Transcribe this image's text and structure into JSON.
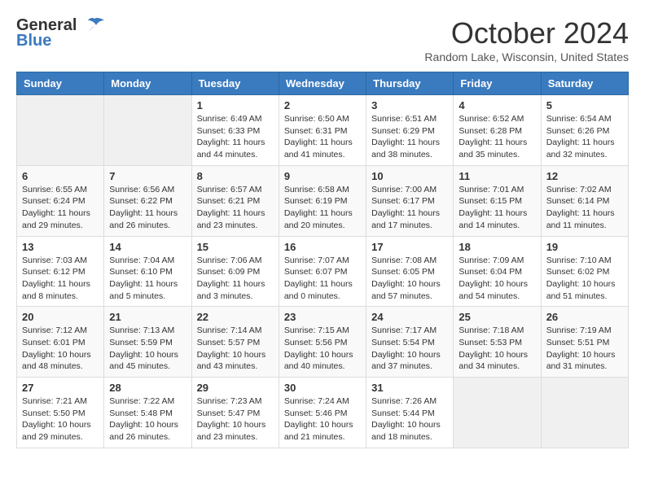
{
  "header": {
    "logo_line1": "General",
    "logo_line2": "Blue",
    "month_title": "October 2024",
    "location": "Random Lake, Wisconsin, United States"
  },
  "days_of_week": [
    "Sunday",
    "Monday",
    "Tuesday",
    "Wednesday",
    "Thursday",
    "Friday",
    "Saturday"
  ],
  "weeks": [
    [
      {
        "day": "",
        "sunrise": "",
        "sunset": "",
        "daylight": ""
      },
      {
        "day": "",
        "sunrise": "",
        "sunset": "",
        "daylight": ""
      },
      {
        "day": "1",
        "sunrise": "Sunrise: 6:49 AM",
        "sunset": "Sunset: 6:33 PM",
        "daylight": "Daylight: 11 hours and 44 minutes."
      },
      {
        "day": "2",
        "sunrise": "Sunrise: 6:50 AM",
        "sunset": "Sunset: 6:31 PM",
        "daylight": "Daylight: 11 hours and 41 minutes."
      },
      {
        "day": "3",
        "sunrise": "Sunrise: 6:51 AM",
        "sunset": "Sunset: 6:29 PM",
        "daylight": "Daylight: 11 hours and 38 minutes."
      },
      {
        "day": "4",
        "sunrise": "Sunrise: 6:52 AM",
        "sunset": "Sunset: 6:28 PM",
        "daylight": "Daylight: 11 hours and 35 minutes."
      },
      {
        "day": "5",
        "sunrise": "Sunrise: 6:54 AM",
        "sunset": "Sunset: 6:26 PM",
        "daylight": "Daylight: 11 hours and 32 minutes."
      }
    ],
    [
      {
        "day": "6",
        "sunrise": "Sunrise: 6:55 AM",
        "sunset": "Sunset: 6:24 PM",
        "daylight": "Daylight: 11 hours and 29 minutes."
      },
      {
        "day": "7",
        "sunrise": "Sunrise: 6:56 AM",
        "sunset": "Sunset: 6:22 PM",
        "daylight": "Daylight: 11 hours and 26 minutes."
      },
      {
        "day": "8",
        "sunrise": "Sunrise: 6:57 AM",
        "sunset": "Sunset: 6:21 PM",
        "daylight": "Daylight: 11 hours and 23 minutes."
      },
      {
        "day": "9",
        "sunrise": "Sunrise: 6:58 AM",
        "sunset": "Sunset: 6:19 PM",
        "daylight": "Daylight: 11 hours and 20 minutes."
      },
      {
        "day": "10",
        "sunrise": "Sunrise: 7:00 AM",
        "sunset": "Sunset: 6:17 PM",
        "daylight": "Daylight: 11 hours and 17 minutes."
      },
      {
        "day": "11",
        "sunrise": "Sunrise: 7:01 AM",
        "sunset": "Sunset: 6:15 PM",
        "daylight": "Daylight: 11 hours and 14 minutes."
      },
      {
        "day": "12",
        "sunrise": "Sunrise: 7:02 AM",
        "sunset": "Sunset: 6:14 PM",
        "daylight": "Daylight: 11 hours and 11 minutes."
      }
    ],
    [
      {
        "day": "13",
        "sunrise": "Sunrise: 7:03 AM",
        "sunset": "Sunset: 6:12 PM",
        "daylight": "Daylight: 11 hours and 8 minutes."
      },
      {
        "day": "14",
        "sunrise": "Sunrise: 7:04 AM",
        "sunset": "Sunset: 6:10 PM",
        "daylight": "Daylight: 11 hours and 5 minutes."
      },
      {
        "day": "15",
        "sunrise": "Sunrise: 7:06 AM",
        "sunset": "Sunset: 6:09 PM",
        "daylight": "Daylight: 11 hours and 3 minutes."
      },
      {
        "day": "16",
        "sunrise": "Sunrise: 7:07 AM",
        "sunset": "Sunset: 6:07 PM",
        "daylight": "Daylight: 11 hours and 0 minutes."
      },
      {
        "day": "17",
        "sunrise": "Sunrise: 7:08 AM",
        "sunset": "Sunset: 6:05 PM",
        "daylight": "Daylight: 10 hours and 57 minutes."
      },
      {
        "day": "18",
        "sunrise": "Sunrise: 7:09 AM",
        "sunset": "Sunset: 6:04 PM",
        "daylight": "Daylight: 10 hours and 54 minutes."
      },
      {
        "day": "19",
        "sunrise": "Sunrise: 7:10 AM",
        "sunset": "Sunset: 6:02 PM",
        "daylight": "Daylight: 10 hours and 51 minutes."
      }
    ],
    [
      {
        "day": "20",
        "sunrise": "Sunrise: 7:12 AM",
        "sunset": "Sunset: 6:01 PM",
        "daylight": "Daylight: 10 hours and 48 minutes."
      },
      {
        "day": "21",
        "sunrise": "Sunrise: 7:13 AM",
        "sunset": "Sunset: 5:59 PM",
        "daylight": "Daylight: 10 hours and 45 minutes."
      },
      {
        "day": "22",
        "sunrise": "Sunrise: 7:14 AM",
        "sunset": "Sunset: 5:57 PM",
        "daylight": "Daylight: 10 hours and 43 minutes."
      },
      {
        "day": "23",
        "sunrise": "Sunrise: 7:15 AM",
        "sunset": "Sunset: 5:56 PM",
        "daylight": "Daylight: 10 hours and 40 minutes."
      },
      {
        "day": "24",
        "sunrise": "Sunrise: 7:17 AM",
        "sunset": "Sunset: 5:54 PM",
        "daylight": "Daylight: 10 hours and 37 minutes."
      },
      {
        "day": "25",
        "sunrise": "Sunrise: 7:18 AM",
        "sunset": "Sunset: 5:53 PM",
        "daylight": "Daylight: 10 hours and 34 minutes."
      },
      {
        "day": "26",
        "sunrise": "Sunrise: 7:19 AM",
        "sunset": "Sunset: 5:51 PM",
        "daylight": "Daylight: 10 hours and 31 minutes."
      }
    ],
    [
      {
        "day": "27",
        "sunrise": "Sunrise: 7:21 AM",
        "sunset": "Sunset: 5:50 PM",
        "daylight": "Daylight: 10 hours and 29 minutes."
      },
      {
        "day": "28",
        "sunrise": "Sunrise: 7:22 AM",
        "sunset": "Sunset: 5:48 PM",
        "daylight": "Daylight: 10 hours and 26 minutes."
      },
      {
        "day": "29",
        "sunrise": "Sunrise: 7:23 AM",
        "sunset": "Sunset: 5:47 PM",
        "daylight": "Daylight: 10 hours and 23 minutes."
      },
      {
        "day": "30",
        "sunrise": "Sunrise: 7:24 AM",
        "sunset": "Sunset: 5:46 PM",
        "daylight": "Daylight: 10 hours and 21 minutes."
      },
      {
        "day": "31",
        "sunrise": "Sunrise: 7:26 AM",
        "sunset": "Sunset: 5:44 PM",
        "daylight": "Daylight: 10 hours and 18 minutes."
      },
      {
        "day": "",
        "sunrise": "",
        "sunset": "",
        "daylight": ""
      },
      {
        "day": "",
        "sunrise": "",
        "sunset": "",
        "daylight": ""
      }
    ]
  ]
}
